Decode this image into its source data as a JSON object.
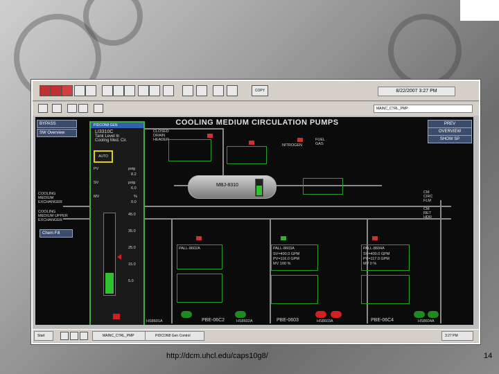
{
  "toolbar": {
    "copy_label": "COPY",
    "datetime": "8/22/2007  3:27 PM"
  },
  "secondary": {
    "screen_id": "MAINC_CTRL_PMP"
  },
  "sidebar": {
    "bypass": "BYPASS",
    "overview": "SW Overview"
  },
  "right_buttons": {
    "prev": "PREV",
    "overview": "OVERVIEW",
    "show_sp": "SHOW SP"
  },
  "title": "COOLING MEDIUM CIRCULATION PUMPS",
  "popup": {
    "header": "PIDCON8 GEN",
    "tag": "LI3310C",
    "line1": "Tank Level In",
    "line2": "Cooling Med. Cir.",
    "auto": "AUTO",
    "pv_unit1": "psig",
    "pv_val1": "8.2",
    "pv_unit2": "psig",
    "pv_val2": "6.0",
    "mv_unit": "%",
    "mv_val": "0.0",
    "scale": [
      "45.0",
      "35.0",
      "25.0",
      "15.0",
      "5.0"
    ]
  },
  "tank": {
    "label": "MBJ-8310"
  },
  "left_labels": {
    "cm_exchanger": [
      "COOLING",
      "MEDIUM",
      "EXCHANGER"
    ],
    "cm_upper": [
      "COOLING",
      "MEDIUM UPPER",
      "EXCHANGER"
    ],
    "chemfill": "Chem Fill"
  },
  "top_labels": {
    "closed": [
      "CLOSED",
      "DRAIN",
      "HEADER"
    ],
    "fuel": [
      "FUEL",
      "GAS"
    ],
    "nitrogen": "NITROGEN"
  },
  "right_labels": {
    "cm_out": [
      "CM",
      "CIRC",
      "FLM"
    ],
    "cm_ret": [
      "CM",
      "RET",
      "HDR"
    ]
  },
  "pumps": [
    {
      "name": "PBE-06C2",
      "alarm": "PALL-8602A",
      "sv": "SV=54.0 GPM",
      "pv": "PV=100.0 GPM",
      "mv": "MV 0 %"
    },
    {
      "name": "PBE-0603",
      "alarm": "PALL-8603A",
      "sv": "SV=400.0 GPM",
      "pv": "PV=116.0 GPM",
      "mv": "MV 100 %"
    },
    {
      "name": "PBE-06C4",
      "alarm": "PALL-8604A",
      "sv": "SV=400.0 GPM",
      "pv": "PV=117.0 GPM",
      "mv": "MV 0 %"
    }
  ],
  "pump_tags": [
    "HS8601A",
    "HS8602A",
    "HS8603A",
    "HS8604A"
  ],
  "taskbar": {
    "start": "Start",
    "task1": "MAINC_CTRL_PMP",
    "task2": "PIDCON8 Gen Control",
    "clock": "3:27 PM"
  },
  "footer": {
    "url": "http://dcm.uhcl.edu/caps10g8/",
    "page": "14"
  }
}
